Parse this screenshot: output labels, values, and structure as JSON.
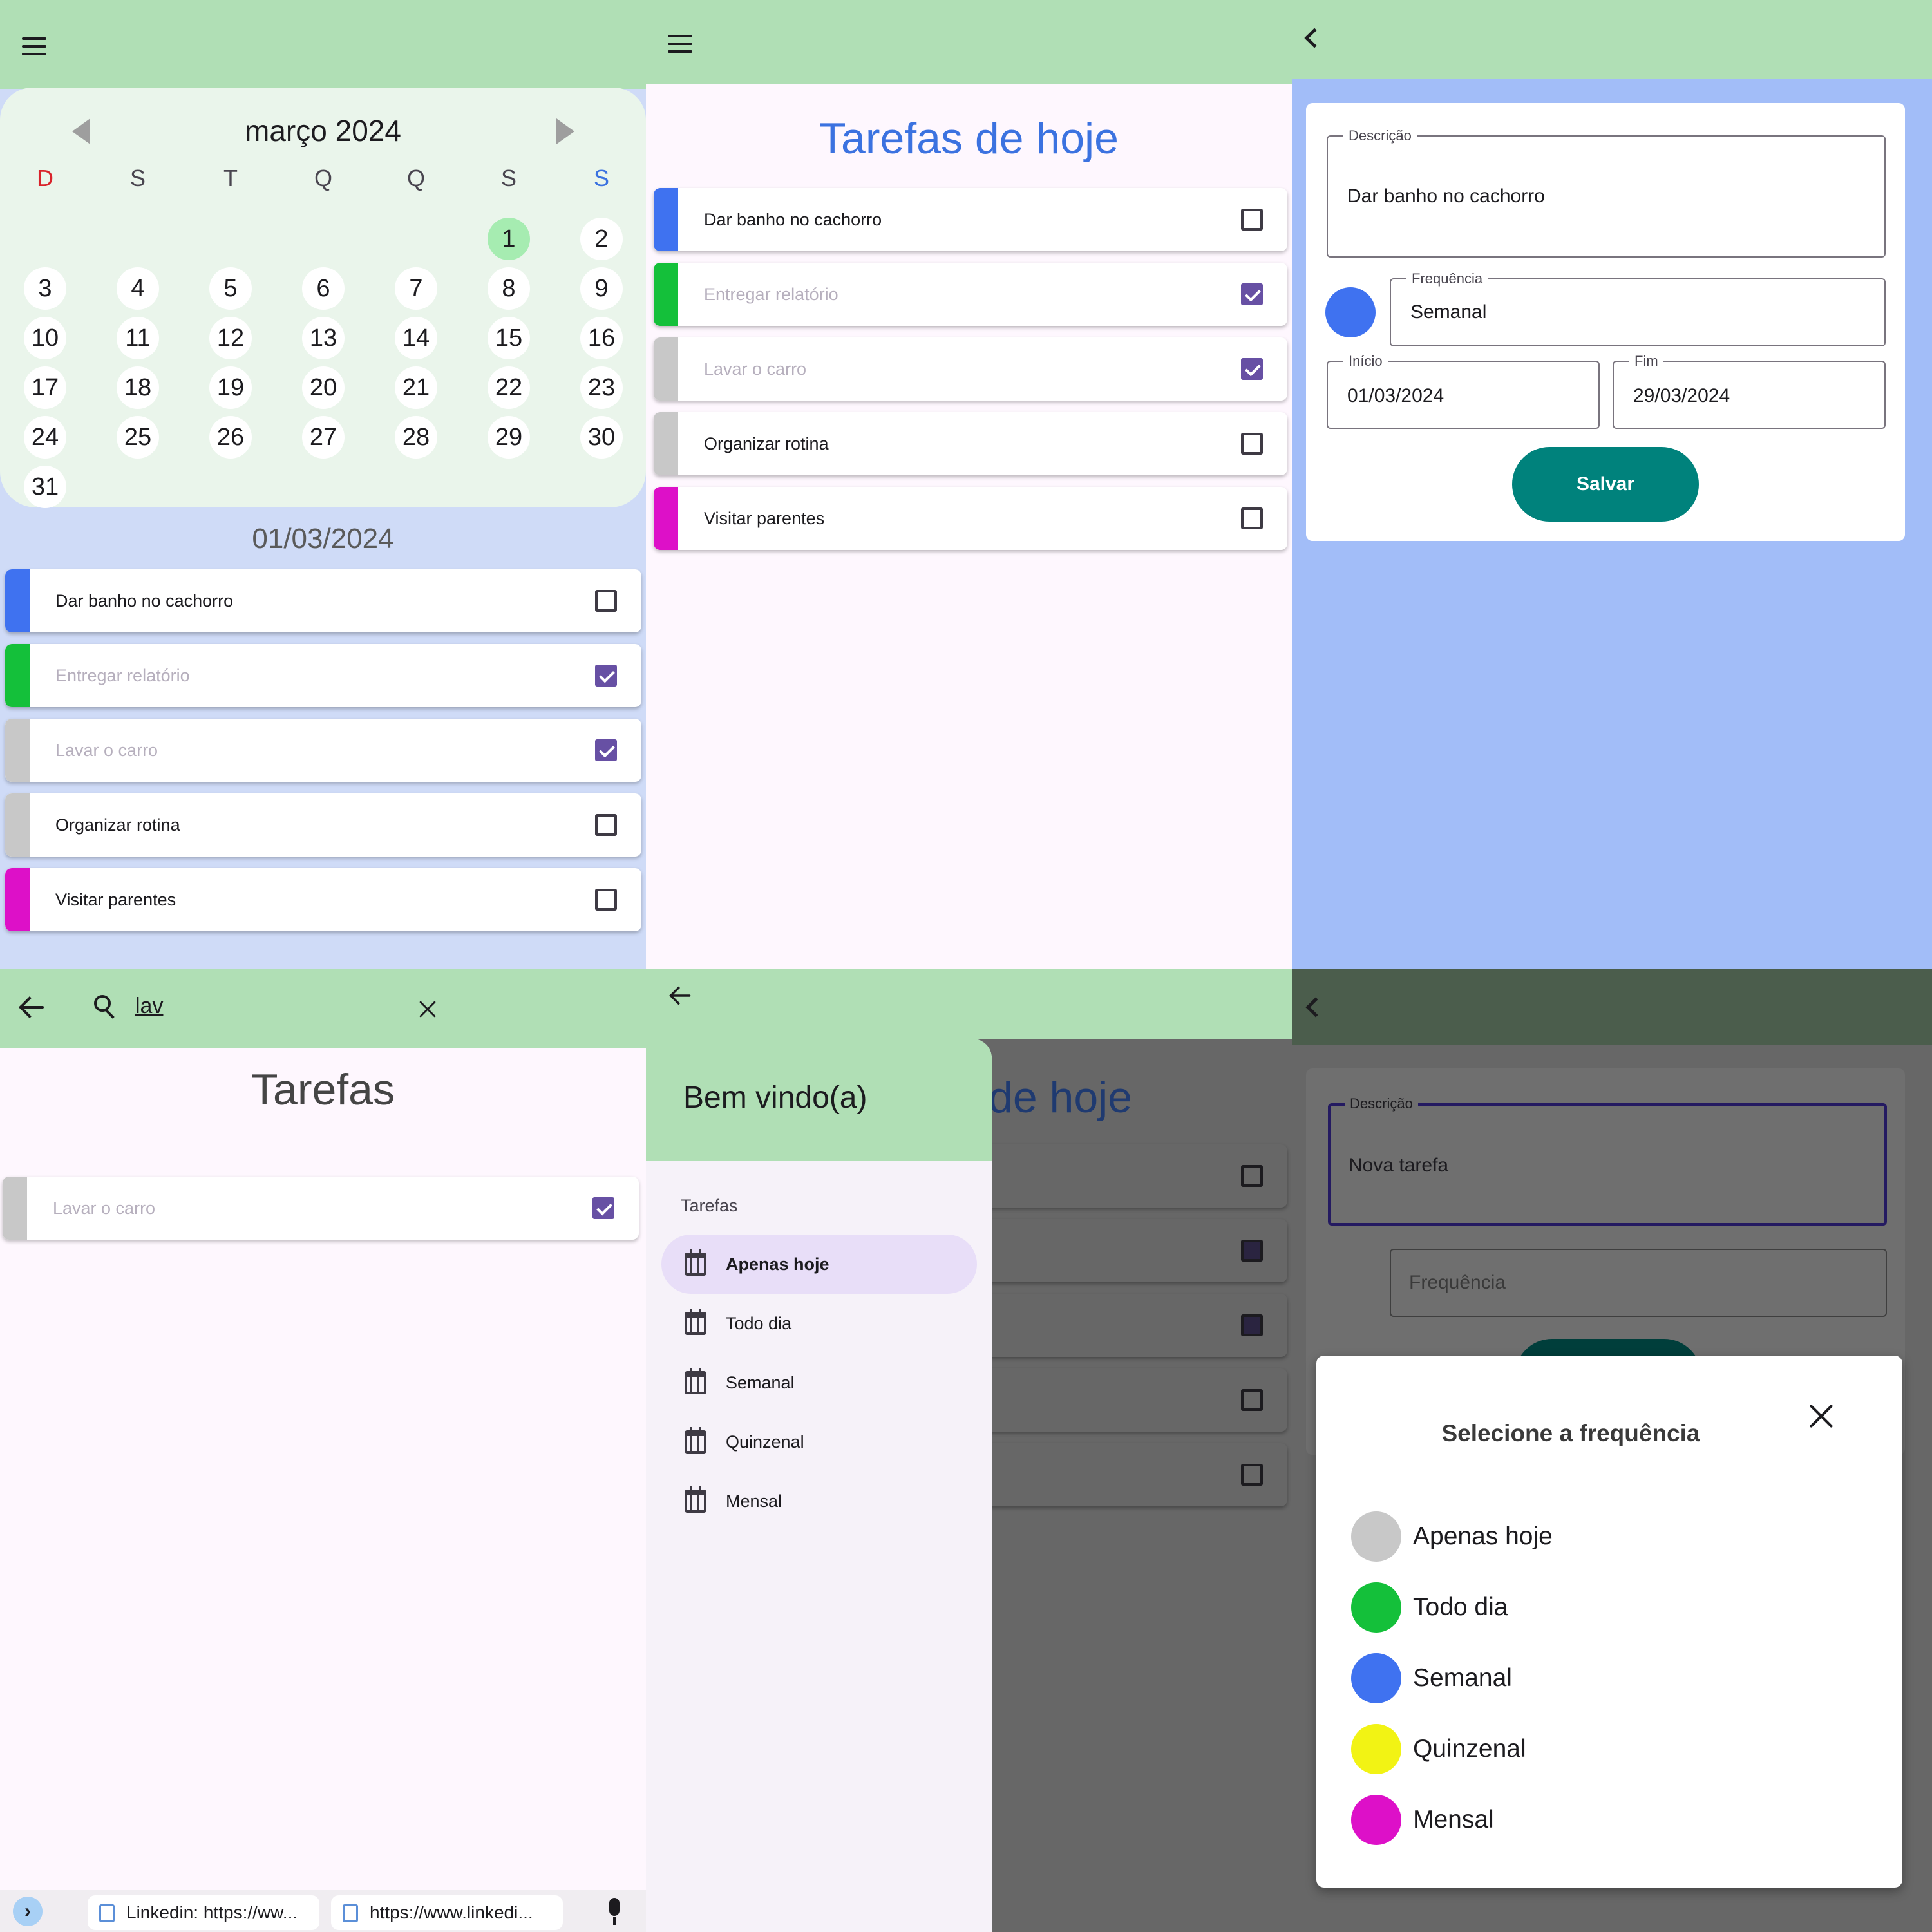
{
  "calendar_screen": {
    "month_title": "março 2024",
    "weekdays": [
      "D",
      "S",
      "T",
      "Q",
      "Q",
      "S",
      "S"
    ],
    "days": [
      "1",
      "2",
      "3",
      "4",
      "5",
      "6",
      "7",
      "8",
      "9",
      "10",
      "11",
      "12",
      "13",
      "14",
      "15",
      "16",
      "17",
      "18",
      "19",
      "20",
      "21",
      "22",
      "23",
      "24",
      "25",
      "26",
      "27",
      "28",
      "29",
      "30",
      "31"
    ],
    "selected_date": "01/03/2024",
    "tasks": [
      {
        "label": "Dar banho no cachorro",
        "color": "#3f72f0",
        "checked": false
      },
      {
        "label": "Entregar relatório",
        "color": "#14c03a",
        "checked": true
      },
      {
        "label": "Lavar o carro",
        "color": "#c8c8c8",
        "checked": true
      },
      {
        "label": "Organizar rotina",
        "color": "#c8c8c8",
        "checked": false
      },
      {
        "label": "Visitar parentes",
        "color": "#dd10c8",
        "checked": false
      }
    ]
  },
  "today_screen": {
    "title": "Tarefas de hoje",
    "tasks": [
      {
        "label": "Dar banho no cachorro",
        "color": "#3f72f0",
        "checked": false
      },
      {
        "label": "Entregar relatório",
        "color": "#14c03a",
        "checked": true
      },
      {
        "label": "Lavar o carro",
        "color": "#c8c8c8",
        "checked": true
      },
      {
        "label": "Organizar rotina",
        "color": "#c8c8c8",
        "checked": false
      },
      {
        "label": "Visitar parentes",
        "color": "#dd10c8",
        "checked": false
      }
    ]
  },
  "edit_screen": {
    "description_label": "Descrição",
    "description_value": "Dar banho no cachorro",
    "frequency_label": "Frequência",
    "frequency_value": "Semanal",
    "frequency_color": "#3f72f0",
    "start_label": "Início",
    "start_value": "01/03/2024",
    "end_label": "Fim",
    "end_value": "29/03/2024",
    "save_label": "Salvar"
  },
  "search_screen": {
    "query": "lav",
    "title": "Tarefas",
    "tasks": [
      {
        "label": "Lavar o carro",
        "color": "#c8c8c8",
        "checked": true
      }
    ],
    "keyboard_suggestions": [
      "Linkedin: https://ww...",
      "https://www.linkedi..."
    ]
  },
  "drawer_screen": {
    "header": "Bem vindo(a)",
    "section_label": "Tarefas",
    "background_title_fragment": "de hoje",
    "items": [
      {
        "label": "Apenas hoje",
        "active": true
      },
      {
        "label": "Todo dia",
        "active": false
      },
      {
        "label": "Semanal",
        "active": false
      },
      {
        "label": "Quinzenal",
        "active": false
      },
      {
        "label": "Mensal",
        "active": false
      }
    ]
  },
  "new_task_screen": {
    "description_label": "Descrição",
    "description_value": "Nova tarefa",
    "frequency_placeholder": "Frequência",
    "dialog_title": "Selecione a frequência",
    "options": [
      {
        "label": "Apenas hoje",
        "color": "#c8c8c8"
      },
      {
        "label": "Todo dia",
        "color": "#14c03a"
      },
      {
        "label": "Semanal",
        "color": "#3f72f0"
      },
      {
        "label": "Quinzenal",
        "color": "#f2f314"
      },
      {
        "label": "Mensal",
        "color": "#dd10c8"
      }
    ]
  }
}
